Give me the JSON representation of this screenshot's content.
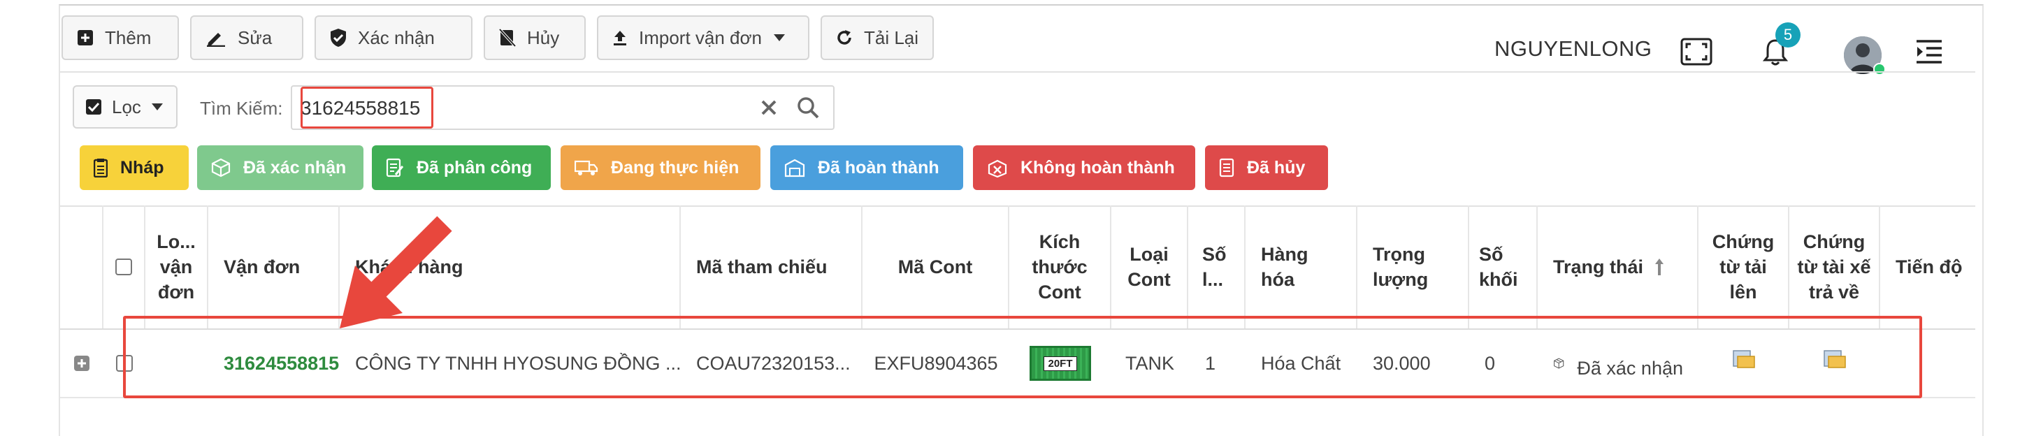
{
  "toolbar": {
    "add_label": "Thêm",
    "edit_label": "Sửa",
    "confirm_label": "Xác nhận",
    "cancel_label": "Hủy",
    "import_label": "Import vận đơn",
    "reload_label": "Tải Lại"
  },
  "header": {
    "username": "NGUYENLONG",
    "notification_count": "5"
  },
  "filter": {
    "filter_label": "Lọc",
    "search_label": "Tìm Kiếm:",
    "search_value": "31624558815"
  },
  "status_buttons": [
    {
      "label": "Nháp",
      "color": "#f7d23a",
      "text_color": "#222",
      "icon": "clipboard-icon"
    },
    {
      "label": "Đã xác nhận",
      "color": "#7fc98d",
      "text_color": "#fff",
      "icon": "box-icon"
    },
    {
      "label": "Đã phân công",
      "color": "#3fae55",
      "text_color": "#fff",
      "icon": "assign-doc-icon"
    },
    {
      "label": "Đang thực hiện",
      "color": "#f0a54a",
      "text_color": "#fff",
      "icon": "truck-icon"
    },
    {
      "label": "Đã hoàn thành",
      "color": "#4a9fdd",
      "text_color": "#fff",
      "icon": "warehouse-icon"
    },
    {
      "label": "Không hoàn thành",
      "color": "#de4a4a",
      "text_color": "#fff",
      "icon": "box-x-icon"
    },
    {
      "label": "Đã hủy",
      "color": "#de4a4a",
      "text_color": "#fff",
      "icon": "cancel-doc-icon"
    }
  ],
  "table": {
    "columns": {
      "bill_type": "Lo... vận đơn",
      "bill": "Vận đơn",
      "customer": "Khách hàng",
      "ref": "Mã tham chiếu",
      "cont": "Mã Cont",
      "size": "Kích thước Cont",
      "type": "Loại Cont",
      "qty": "Số l...",
      "goods": "Hàng hóa",
      "weight": "Trọng lượng",
      "volume": "Số khối",
      "status": "Trạng thái",
      "docs_uploaded": "Chứng từ tải lên",
      "docs_returned": "Chứng từ tài xế trả về",
      "progress": "Tiến độ"
    },
    "rows": [
      {
        "bill": "31624558815",
        "customer": "CÔNG TY TNHH HYOSUNG ĐỒNG ...",
        "ref": "COAU72320153...",
        "cont": "EXFU8904365",
        "size_badge": "20FT",
        "type": "TANK",
        "qty": "1",
        "goods": "Hóa Chất",
        "weight": "30.000",
        "volume": "0",
        "status": "Đã xác nhận"
      }
    ]
  },
  "colors": {
    "accent_green": "#2e8b3e",
    "highlight_red": "#e8473d",
    "badge_teal": "#17a2b8"
  }
}
